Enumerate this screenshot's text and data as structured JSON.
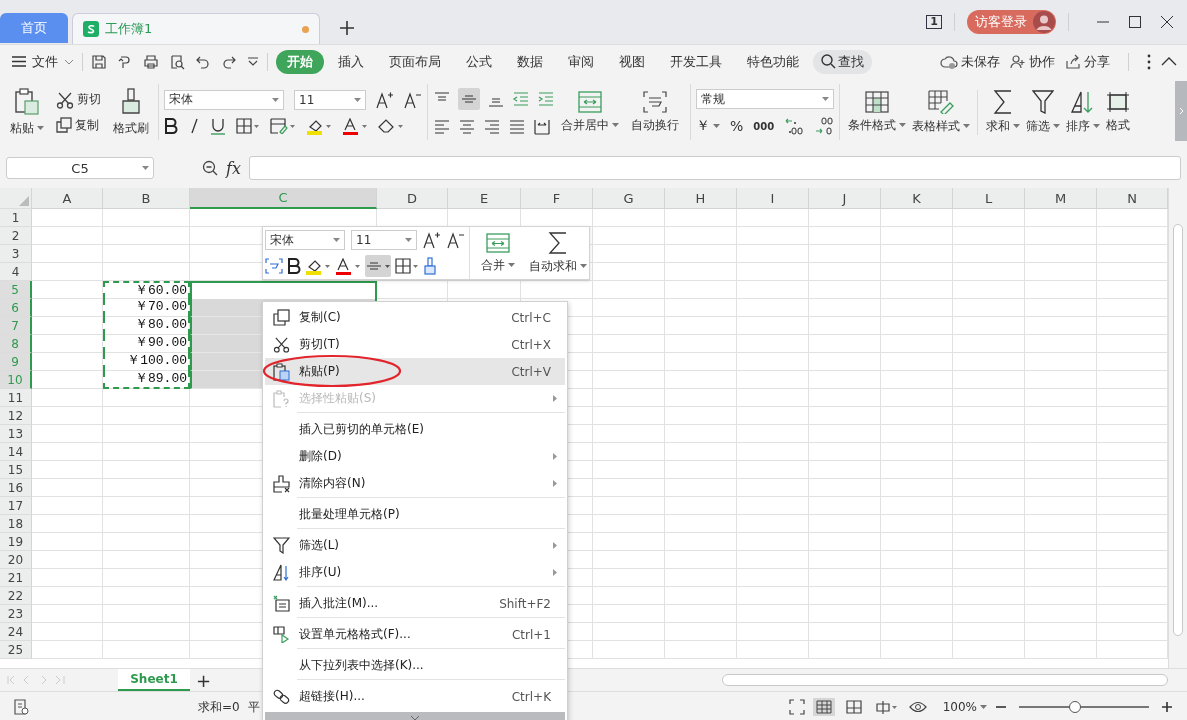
{
  "title_bar": {
    "home_tab": {
      "label": "首页",
      "selected": false
    },
    "doc_tab": {
      "label": "工作簿1",
      "selected": true,
      "unsaved": true
    },
    "page_count": "1",
    "account_button": "访客登录"
  },
  "menu_bar": {
    "file_menu": "文件",
    "tabs": [
      {
        "label": "开始",
        "selected": true
      },
      {
        "label": "插入",
        "selected": false
      },
      {
        "label": "页面布局",
        "selected": false
      },
      {
        "label": "公式",
        "selected": false
      },
      {
        "label": "数据",
        "selected": false
      },
      {
        "label": "审阅",
        "selected": false
      },
      {
        "label": "视图",
        "selected": false
      },
      {
        "label": "开发工具",
        "selected": false
      },
      {
        "label": "特色功能",
        "selected": false
      }
    ],
    "search": "查找",
    "actions": [
      "未保存",
      "协作",
      "分享"
    ]
  },
  "ribbon": {
    "paste": "粘贴",
    "cut": "剪切",
    "copy": "复制",
    "format_painter": "格式刷",
    "font_name": "宋体",
    "font_size": "11",
    "merge": "合并居中",
    "wrap": "自动换行",
    "number_format": "常规",
    "currency": "￥",
    "percent": "%",
    "thousands": "000",
    "tools": [
      "条件格式",
      "表格样式",
      "求和",
      "筛选",
      "排序",
      "格式"
    ]
  },
  "formula_bar": {
    "name_box": "C5",
    "fx": "fx"
  },
  "sheet": {
    "columns": [
      {
        "label": "A",
        "selected": false
      },
      {
        "label": "B",
        "selected": false
      },
      {
        "label": "C",
        "selected": true
      },
      {
        "label": "D",
        "selected": false
      },
      {
        "label": "E",
        "selected": false
      },
      {
        "label": "F",
        "selected": false
      },
      {
        "label": "G",
        "selected": false
      },
      {
        "label": "H",
        "selected": false
      },
      {
        "label": "I",
        "selected": false
      },
      {
        "label": "J",
        "selected": false
      },
      {
        "label": "K",
        "selected": false
      },
      {
        "label": "L",
        "selected": false
      },
      {
        "label": "M",
        "selected": false
      },
      {
        "label": "N",
        "selected": false
      }
    ],
    "rows": [
      {
        "label": "1",
        "selected": false,
        "copied": false
      },
      {
        "label": "2",
        "selected": false,
        "copied": false
      },
      {
        "label": "3",
        "selected": false,
        "copied": false
      },
      {
        "label": "4",
        "selected": false,
        "copied": false
      },
      {
        "label": "5",
        "selected": true,
        "copied": true,
        "B": "￥60.00"
      },
      {
        "label": "6",
        "selected": true,
        "copied": true,
        "B": "￥70.00"
      },
      {
        "label": "7",
        "selected": true,
        "copied": true,
        "B": "￥80.00"
      },
      {
        "label": "8",
        "selected": true,
        "copied": true,
        "B": "￥90.00"
      },
      {
        "label": "9",
        "selected": true,
        "copied": true,
        "B": "￥100.00"
      },
      {
        "label": "10",
        "selected": true,
        "copied": true,
        "B": "￥89.00"
      },
      {
        "label": "11",
        "selected": false,
        "copied": false
      },
      {
        "label": "12",
        "selected": false,
        "copied": false
      },
      {
        "label": "13",
        "selected": false,
        "copied": false
      },
      {
        "label": "14",
        "selected": false,
        "copied": false
      },
      {
        "label": "15",
        "selected": false,
        "copied": false
      },
      {
        "label": "16",
        "selected": false,
        "copied": false
      },
      {
        "label": "17",
        "selected": false,
        "copied": false
      },
      {
        "label": "18",
        "selected": false,
        "copied": false
      },
      {
        "label": "19",
        "selected": false,
        "copied": false
      },
      {
        "label": "20",
        "selected": false,
        "copied": false
      },
      {
        "label": "21",
        "selected": false,
        "copied": false
      },
      {
        "label": "22",
        "selected": false,
        "copied": false
      },
      {
        "label": "23",
        "selected": false,
        "copied": false
      },
      {
        "label": "24",
        "selected": false,
        "copied": false
      },
      {
        "label": "25",
        "selected": false,
        "copied": false
      }
    ]
  },
  "mini_toolbar": {
    "font_name": "宋体",
    "font_size": "11",
    "align_on": true,
    "merge": "合并",
    "autosum": "自动求和"
  },
  "context_menu": {
    "items": [
      {
        "label": "复制(C)",
        "shortcut": "Ctrl+C",
        "disabled": false,
        "selected": false,
        "submenu": false,
        "divider_above": false
      },
      {
        "label": "剪切(T)",
        "shortcut": "Ctrl+X",
        "disabled": false,
        "selected": false,
        "submenu": false,
        "divider_above": false
      },
      {
        "label": "粘贴(P)",
        "shortcut": "Ctrl+V",
        "disabled": false,
        "selected": true,
        "submenu": false,
        "divider_above": false
      },
      {
        "label": "选择性粘贴(S)",
        "disabled": true,
        "selected": false,
        "submenu": true,
        "divider_above": false
      },
      {
        "label": "插入已剪切的单元格(E)",
        "disabled": false,
        "selected": false,
        "submenu": false,
        "divider_above": true
      },
      {
        "label": "删除(D)",
        "disabled": false,
        "selected": false,
        "submenu": true,
        "divider_above": false
      },
      {
        "label": "清除内容(N)",
        "disabled": false,
        "selected": false,
        "submenu": true,
        "divider_above": false
      },
      {
        "label": "批量处理单元格(P)",
        "disabled": false,
        "selected": false,
        "submenu": false,
        "divider_above": true
      },
      {
        "label": "筛选(L)",
        "disabled": false,
        "selected": false,
        "submenu": true,
        "divider_above": true
      },
      {
        "label": "排序(U)",
        "disabled": false,
        "selected": false,
        "submenu": true,
        "divider_above": false
      },
      {
        "label": "插入批注(M)...",
        "shortcut": "Shift+F2",
        "disabled": false,
        "selected": false,
        "submenu": false,
        "divider_above": true
      },
      {
        "label": "设置单元格格式(F)...",
        "shortcut": "Ctrl+1",
        "disabled": false,
        "selected": false,
        "submenu": false,
        "divider_above": true
      },
      {
        "label": "从下拉列表中选择(K)...",
        "disabled": false,
        "selected": false,
        "submenu": false,
        "divider_above": true
      },
      {
        "label": "超链接(H)...",
        "shortcut": "Ctrl+K",
        "disabled": false,
        "selected": false,
        "submenu": false,
        "divider_above": true
      }
    ]
  },
  "sheet_tabs": {
    "tabs": [
      {
        "label": "Sheet1",
        "selected": true
      }
    ],
    "add": "+"
  },
  "status_bar": {
    "sum": "求和=0",
    "average": "平",
    "views": [
      {
        "selected": true
      },
      {
        "selected": false
      },
      {
        "selected": false
      }
    ],
    "zoom": "100%",
    "zoom_slider": {
      "level": 0.42
    }
  }
}
